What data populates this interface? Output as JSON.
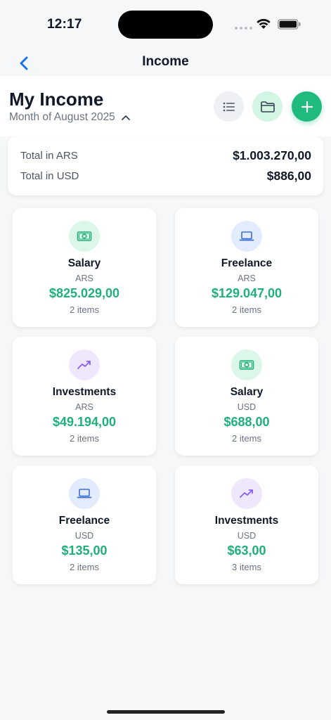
{
  "status_bar": {
    "time": "12:17"
  },
  "nav": {
    "title": "Income"
  },
  "header": {
    "title": "My Income",
    "period": "Month of August 2025"
  },
  "totals": {
    "rows": [
      {
        "label": "Total in ARS",
        "value": "$1.003.270,00"
      },
      {
        "label": "Total in USD",
        "value": "$886,00"
      }
    ]
  },
  "categories": [
    {
      "name": "Salary",
      "currency": "ARS",
      "amount": "$825.029,00",
      "items": "2 items",
      "icon": "money-icon",
      "color": "#1fb07a"
    },
    {
      "name": "Freelance",
      "currency": "ARS",
      "amount": "$129.047,00",
      "items": "2 items",
      "icon": "laptop-icon",
      "color": "#3b6fd8"
    },
    {
      "name": "Investments",
      "currency": "ARS",
      "amount": "$49.194,00",
      "items": "2 items",
      "icon": "trending-up-icon",
      "color": "#8b5cf6"
    },
    {
      "name": "Salary",
      "currency": "USD",
      "amount": "$688,00",
      "items": "2 items",
      "icon": "money-icon",
      "color": "#1fb07a"
    },
    {
      "name": "Freelance",
      "currency": "USD",
      "amount": "$135,00",
      "items": "2 items",
      "icon": "laptop-icon",
      "color": "#3b6fd8"
    },
    {
      "name": "Investments",
      "currency": "USD",
      "amount": "$63,00",
      "items": "3 items",
      "icon": "trending-up-icon",
      "color": "#8b5cf6"
    }
  ],
  "colors": {
    "accent": "#1fba7e",
    "link": "#1a73e8",
    "amount": "#1fb07a"
  }
}
